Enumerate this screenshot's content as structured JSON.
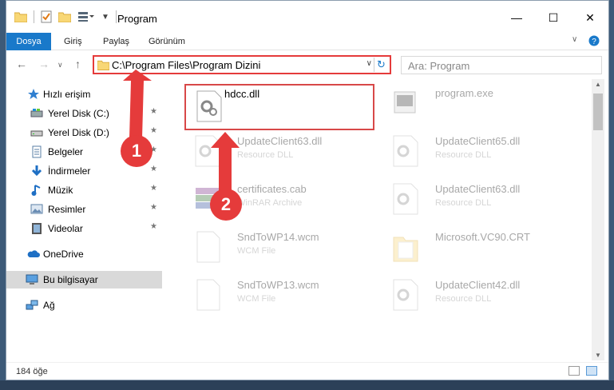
{
  "window": {
    "title": "Program",
    "minimize_glyph": "—",
    "maximize_glyph": "☐",
    "close_glyph": "✕"
  },
  "ribbon": {
    "file_tab": "Dosya",
    "tabs": [
      "Giriş",
      "Paylaş",
      "Görünüm"
    ]
  },
  "address": {
    "path": "C:\\Program Files\\Program Dizini"
  },
  "search": {
    "placeholder": "Ara: Program"
  },
  "nav": {
    "quick_access": "Hızlı erişim",
    "items": [
      "Yerel Disk (C:)",
      "Yerel Disk (D:)",
      "Belgeler",
      "İndirmeler",
      "Müzik",
      "Resimler",
      "Videolar"
    ],
    "onedrive": "OneDrive",
    "this_pc": "Bu bilgisayar",
    "network": "Ağ"
  },
  "files": [
    {
      "name": "hdcc.dll",
      "type": ""
    },
    {
      "name": "program.exe",
      "type": ""
    },
    {
      "name": "UpdateClient63.dll",
      "type": "Resource DLL"
    },
    {
      "name": "UpdateClient65.dll",
      "type": "Resource DLL"
    },
    {
      "name": "certificates.cab",
      "type": "WinRAR Archive"
    },
    {
      "name": "UpdateClient63.dll",
      "type": "Resource DLL"
    },
    {
      "name": "SndToWP14.wcm",
      "type": "WCM File"
    },
    {
      "name": "Microsoft.VC90.CRT",
      "type": ""
    },
    {
      "name": "SndToWP13.wcm",
      "type": "WCM File"
    },
    {
      "name": "UpdateClient42.dll",
      "type": "Resource DLL"
    }
  ],
  "status": {
    "item_count": "184 öğe"
  },
  "markers": [
    "1",
    "2"
  ],
  "colors": {
    "accent": "#1979ca",
    "highlight": "#e53b3b"
  }
}
